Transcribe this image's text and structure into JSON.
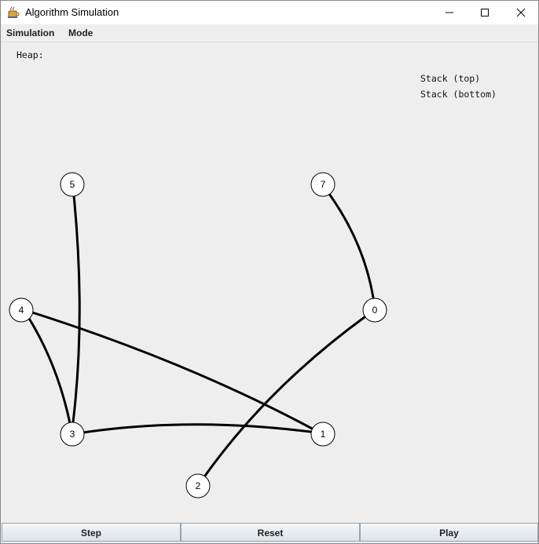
{
  "window": {
    "title": "Algorithm Simulation",
    "icon": "java-cup-icon"
  },
  "menu": {
    "items": [
      {
        "label": "Simulation"
      },
      {
        "label": "Mode"
      }
    ]
  },
  "panel": {
    "heap_label": "Heap:",
    "stack_top_label": "Stack (top)",
    "stack_bottom_label": "Stack (bottom)"
  },
  "graph": {
    "nodes": [
      "5",
      "7",
      "4",
      "0",
      "3",
      "1",
      "2"
    ],
    "edges": [
      [
        "5",
        "3"
      ],
      [
        "7",
        "0"
      ],
      [
        "4",
        "3"
      ],
      [
        "4",
        "1"
      ],
      [
        "3",
        "1"
      ],
      [
        "0",
        "2"
      ]
    ],
    "colors": {
      "node_fill": "#ffffff",
      "stroke": "#000000"
    }
  },
  "buttons": {
    "step": "Step",
    "reset": "Reset",
    "play": "Play"
  }
}
